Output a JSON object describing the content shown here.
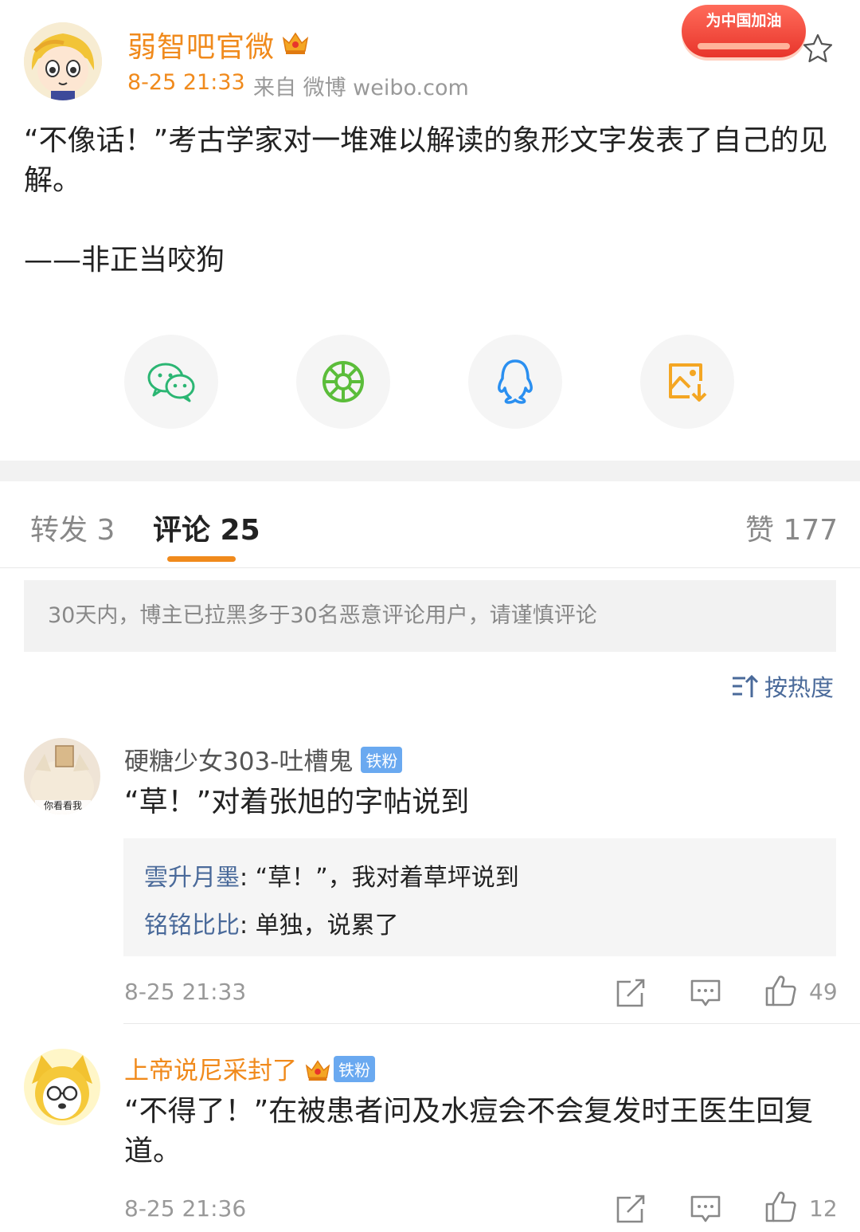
{
  "post": {
    "author": "弱智吧官微",
    "time": "8-25 21:33",
    "source": "来自 微博 weibo.com",
    "promo_badge": "为中国加油",
    "text": "“不像话！”考古学家对一堆难以解读的象形文字发表了自己的见解。\n\n——非正当咬狗"
  },
  "share": {
    "items": [
      "wechat-icon",
      "moments-icon",
      "qq-icon",
      "save-image-icon"
    ]
  },
  "tabs": {
    "repost": "转发 3",
    "comments": "评论 25",
    "likes": "赞 177"
  },
  "notice": "30天内，博主已拉黑多于30名恶意评论用户，请谨慎评论",
  "sort": {
    "label": "按热度"
  },
  "comments": [
    {
      "user": "硬糖少女303-吐槽鬼",
      "badge": "铁粉",
      "avatar_caption": "你看看我",
      "text": "“草！”对着张旭的字帖说到",
      "replies": [
        {
          "user": "雲升月墨",
          "text": ": “草！”，我对着草坪说到"
        },
        {
          "user": "铭铭比比",
          "text": ": 单独，说累了"
        }
      ],
      "time": "8-25 21:33",
      "likes": "49"
    },
    {
      "user": "上帝说尼采封了",
      "badge": "铁粉",
      "text": "“不得了！”在被患者问及水痘会不会复发时王医生回复道。",
      "time": "8-25 21:36",
      "likes": "12"
    }
  ],
  "colors": {
    "accent_orange": "#f08a1c",
    "link_blue": "#4a6a9a",
    "badge_blue": "#6aa9f0",
    "promo_red": "#e8352b"
  }
}
